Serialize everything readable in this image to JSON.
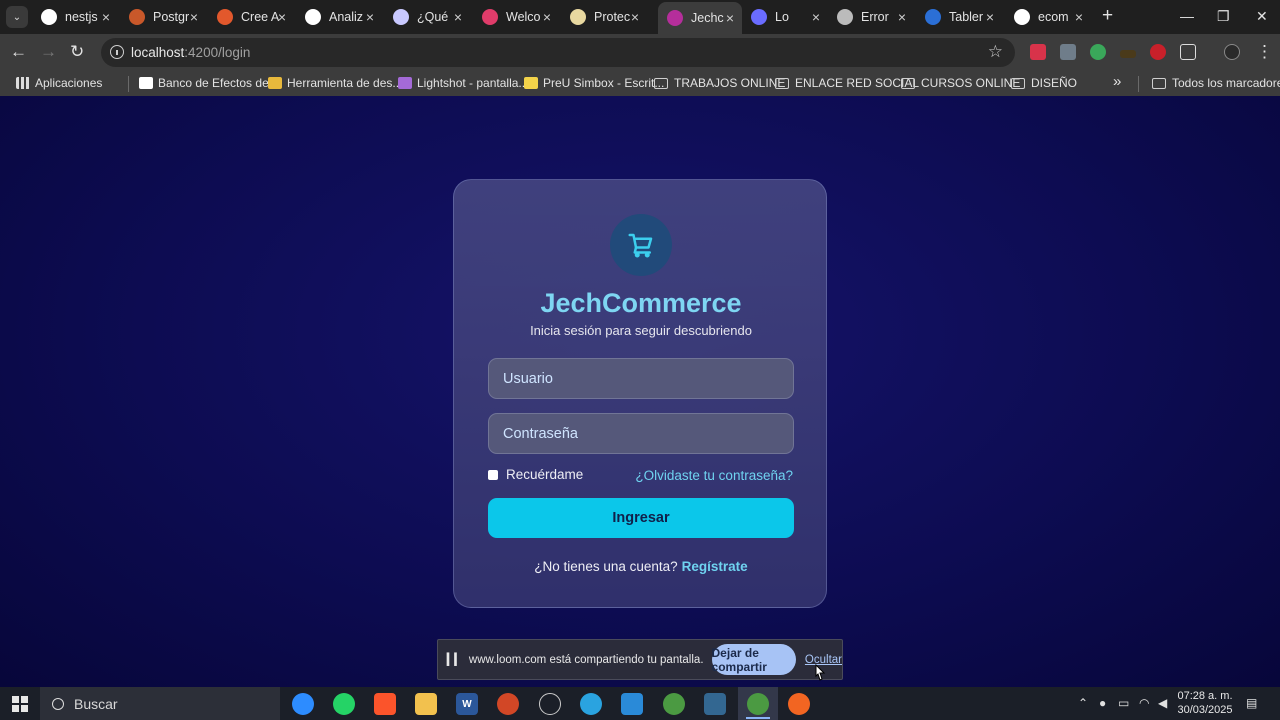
{
  "browser": {
    "tabs": [
      {
        "title": "nestjs",
        "color": "#ffffff",
        "icon": "github-icon"
      },
      {
        "title": "Postgr",
        "color": "#c9582a",
        "icon": "postgres-icon"
      },
      {
        "title": "Cree A",
        "color": "#e2582c",
        "icon": "diamond-icon"
      },
      {
        "title": "Analiz",
        "color": "#ffffff",
        "icon": "github-icon"
      },
      {
        "title": "¿Qué",
        "color": "#c9c9ff",
        "icon": "angular-a-icon"
      },
      {
        "title": "Welco",
        "color": "#e03c6a",
        "icon": "nestjs-icon"
      },
      {
        "title": "Protec",
        "color": "#e8d8a0",
        "icon": "egg-icon"
      },
      {
        "title": "Jechc",
        "color": "#b52e9b",
        "icon": "angular-icon"
      },
      {
        "title": "Lo",
        "color": "#6a6cff",
        "icon": "loom-icon"
      },
      {
        "title": "Error",
        "color": "#bbbbbb",
        "icon": "chatgpt-icon"
      },
      {
        "title": "Tabler",
        "color": "#2b6fd6",
        "icon": "terminal-icon"
      },
      {
        "title": "ecom",
        "color": "#ffffff",
        "icon": "link-icon"
      }
    ],
    "active_tab": 7,
    "url_host": "localhost",
    "url_rest": ":4200/login",
    "bookmarks": [
      {
        "label": "Aplicaciones",
        "type": "apps"
      },
      {
        "label": "Banco de Efectos de...",
        "type": "site",
        "color": "#ffffff"
      },
      {
        "label": "Herramienta de des...",
        "type": "site",
        "color": "#e8b93c"
      },
      {
        "label": "Lightshot - pantalla...",
        "type": "site",
        "color": "#a46ad8"
      },
      {
        "label": "PreU Simbox - Escrit...",
        "type": "site",
        "color": "#f3d34a"
      },
      {
        "label": "TRABAJOS ONLINE",
        "type": "folder"
      },
      {
        "label": "ENLACE RED SOCIAL",
        "type": "folder"
      },
      {
        "label": "CURSOS ONLINE",
        "type": "folder"
      },
      {
        "label": "DISEÑO",
        "type": "folder"
      }
    ],
    "bookmarks_overflow": "»",
    "all_bookmarks": "Todos los marcadores"
  },
  "login": {
    "brand": "JechCommerce",
    "tagline": "Inicia sesión para seguir descubriendo",
    "username_placeholder": "Usuario",
    "password_placeholder": "Contraseña",
    "remember_label": "Recuérdame",
    "forgot_label": "¿Olvidaste tu contraseña?",
    "login_button": "Ingresar",
    "no_account": "¿No tienes una cuenta?",
    "register_link": "Regístrate",
    "colors": {
      "accent": "#0bc7ea",
      "brand": "#7ed6f2",
      "link": "#6fd3f0"
    }
  },
  "sharebar": {
    "message": "www.loom.com está compartiendo tu pantalla.",
    "stop_button": "Dejar de compartir",
    "hide_link": "Ocultar"
  },
  "taskbar": {
    "search_placeholder": "Buscar",
    "time": "07:28 a. m.",
    "date": "30/03/2025"
  }
}
